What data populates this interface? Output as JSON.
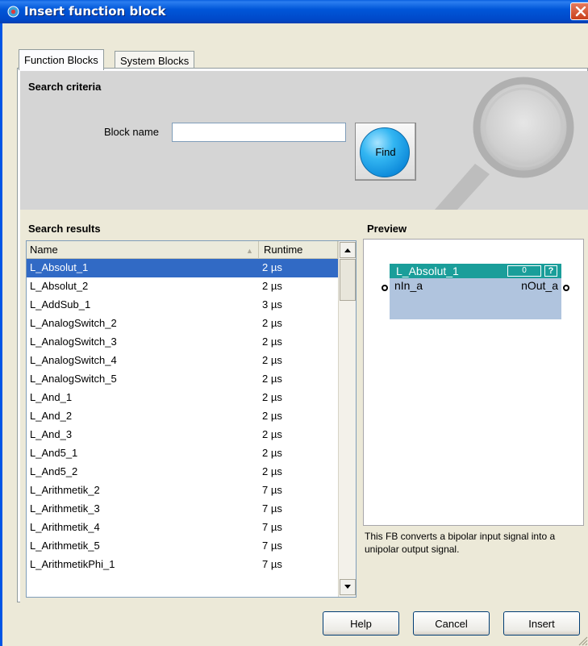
{
  "window": {
    "title": "Insert function block"
  },
  "tabs": [
    {
      "label": "Function Blocks",
      "active": true
    },
    {
      "label": "System Blocks",
      "active": false
    }
  ],
  "search": {
    "title": "Search criteria",
    "block_name_label": "Block name",
    "block_name_value": "",
    "find_label": "Find"
  },
  "results": {
    "title": "Search results",
    "columns": [
      "Name",
      "Runtime"
    ],
    "rows": [
      {
        "name": "L_Absolut_1",
        "runtime": "2 µs",
        "selected": true
      },
      {
        "name": "L_Absolut_2",
        "runtime": "2 µs"
      },
      {
        "name": "L_AddSub_1",
        "runtime": "3 µs"
      },
      {
        "name": "L_AnalogSwitch_2",
        "runtime": "2 µs"
      },
      {
        "name": "L_AnalogSwitch_3",
        "runtime": "2 µs"
      },
      {
        "name": "L_AnalogSwitch_4",
        "runtime": "2 µs"
      },
      {
        "name": "L_AnalogSwitch_5",
        "runtime": "2 µs"
      },
      {
        "name": "L_And_1",
        "runtime": "2 µs"
      },
      {
        "name": "L_And_2",
        "runtime": "2 µs"
      },
      {
        "name": "L_And_3",
        "runtime": "2 µs"
      },
      {
        "name": "L_And5_1",
        "runtime": "2 µs"
      },
      {
        "name": "L_And5_2",
        "runtime": "2 µs"
      },
      {
        "name": "L_Arithmetik_2",
        "runtime": "7 µs"
      },
      {
        "name": "L_Arithmetik_3",
        "runtime": "7 µs"
      },
      {
        "name": "L_Arithmetik_4",
        "runtime": "7 µs"
      },
      {
        "name": "L_Arithmetik_5",
        "runtime": "7 µs"
      },
      {
        "name": "L_ArithmetikPhi_1",
        "runtime": "7 µs"
      }
    ]
  },
  "preview": {
    "title": "Preview",
    "block_name": "L_Absolut_1",
    "block_index": "0",
    "help_glyph": "?",
    "input_pin": "nIn_a",
    "output_pin": "nOut_a",
    "description": "This FB converts a bipolar input signal into a unipolar output signal."
  },
  "buttons": {
    "help": "Help",
    "cancel": "Cancel",
    "insert": "Insert"
  },
  "colors": {
    "title_bar": "#0054E3",
    "selection": "#316AC5",
    "block_header": "#1A9E9A",
    "block_body": "#B0C4DE",
    "find_button": "#1AA0EA"
  },
  "icons": [
    "app-icon",
    "close-icon",
    "magnifier-graphic",
    "sort-icon",
    "scroll-up-icon",
    "scroll-down-icon",
    "resize-grip-icon"
  ]
}
